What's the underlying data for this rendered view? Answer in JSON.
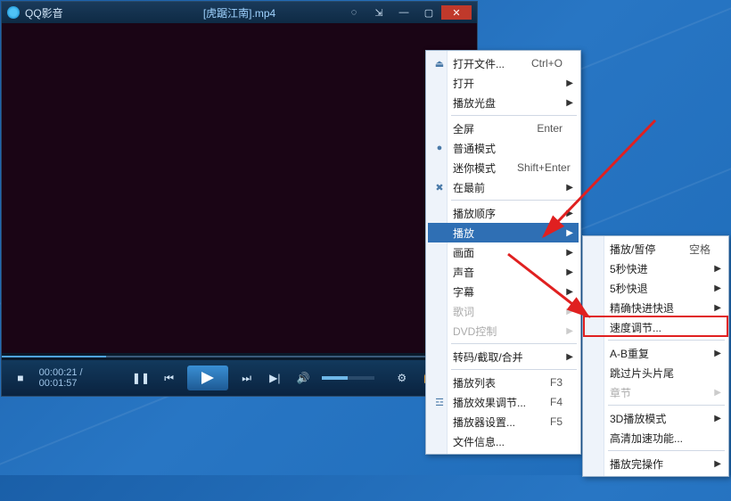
{
  "app": {
    "name": "QQ影音",
    "file": "[虎踞江南].mp4"
  },
  "time": {
    "current": "00:00:21",
    "total": "00:01:57"
  },
  "menu1": {
    "open_file": "打开文件...",
    "open_file_sc": "Ctrl+O",
    "open": "打开",
    "play_disc": "播放光盘",
    "fullscreen": "全屏",
    "fullscreen_sc": "Enter",
    "normal_mode": "普通模式",
    "mini_mode": "迷你模式",
    "mini_mode_sc": "Shift+Enter",
    "on_top": "在最前",
    "play_order": "播放顺序",
    "play": "播放",
    "picture": "画面",
    "sound": "声音",
    "subtitle": "字幕",
    "lyrics": "歌词",
    "dvd_ctrl": "DVD控制",
    "transcode": "转码/截取/合并",
    "playlist": "播放列表",
    "playlist_sc": "F3",
    "effect": "播放效果调节...",
    "effect_sc": "F4",
    "settings": "播放器设置...",
    "settings_sc": "F5",
    "fileinfo": "文件信息..."
  },
  "menu2": {
    "play_pause": "播放/暂停",
    "play_pause_sc": "空格",
    "ff5": "5秒快进",
    "rw5": "5秒快退",
    "precise": "精确快进快退",
    "speed": "速度调节...",
    "ab": "A-B重复",
    "skip": "跳过片头片尾",
    "chapter": "章节",
    "mode3d": "3D播放模式",
    "hwaccel": "高清加速功能...",
    "after": "播放完操作"
  }
}
